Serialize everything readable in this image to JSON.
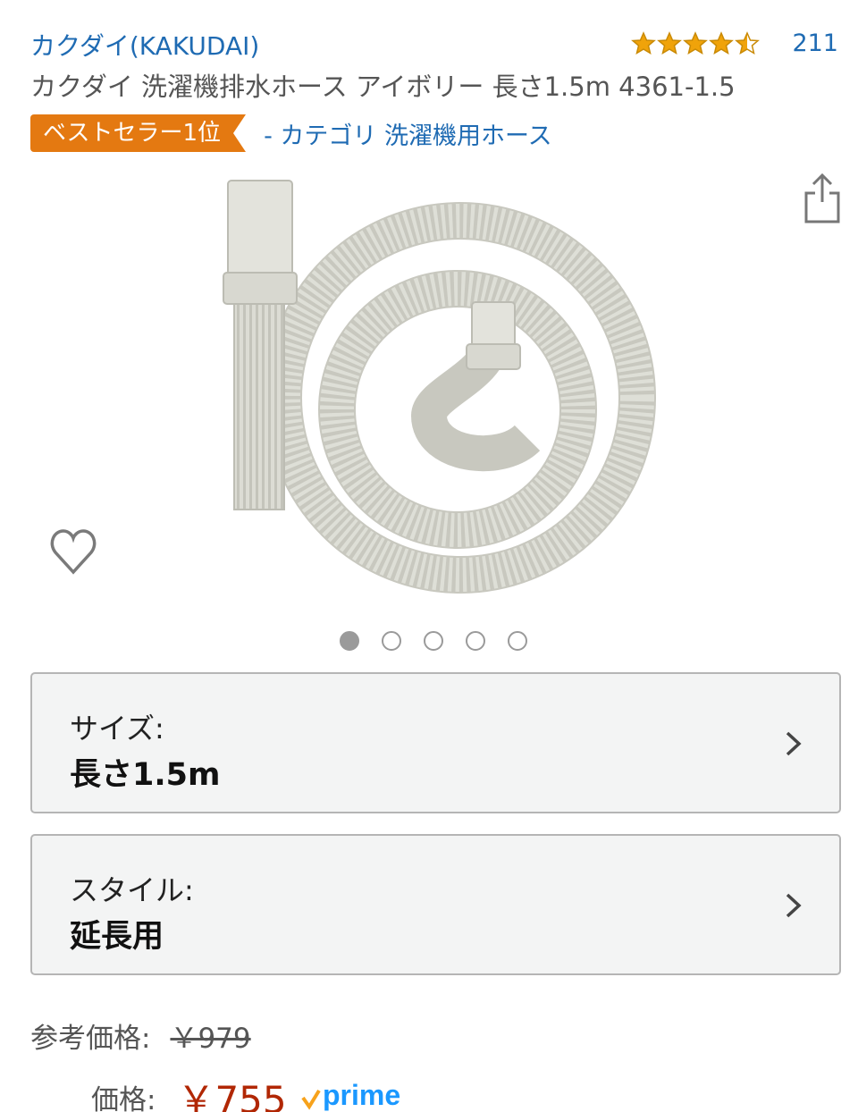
{
  "brand": {
    "name": "カクダイ(KAKUDAI)"
  },
  "rating": {
    "stars": 4.5,
    "count": "211"
  },
  "product": {
    "title": "カクダイ 洗濯機排水ホース アイボリー 長さ1.5m 4361-1.5"
  },
  "badge": {
    "label": "ベストセラー1位",
    "category": "- カテゴリ 洗濯機用ホース"
  },
  "gallery": {
    "total": 5,
    "active_index": 0
  },
  "options": [
    {
      "label": "サイズ:",
      "value": "長さ1.5m"
    },
    {
      "label": "スタイル:",
      "value": "延長用"
    }
  ],
  "pricing": {
    "list_label": "参考価格:",
    "list_price": "￥979",
    "price_label": "価格:",
    "price": "￥755",
    "prime": "prime"
  },
  "colors": {
    "link": "#1f6bb3",
    "badge": "#e47911",
    "price": "#b12704",
    "star": "#f0a30a",
    "prime": "#1a98ff",
    "prime_check": "#f7a21b"
  },
  "icons": {
    "share": "share-icon",
    "wishlist": "heart-icon",
    "chevron": "chevron-right-icon"
  }
}
